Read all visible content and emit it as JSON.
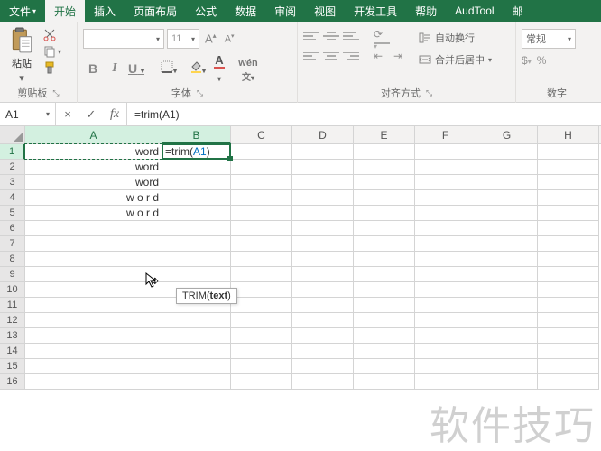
{
  "tabs": {
    "file": "文件",
    "home": "开始",
    "insert": "插入",
    "layout": "页面布局",
    "formula": "公式",
    "data": "数据",
    "review": "审阅",
    "view": "视图",
    "dev": "开发工具",
    "help": "帮助",
    "aud": "AudTool",
    "mail": "邮"
  },
  "clipboard": {
    "paste": "粘贴",
    "label": "剪贴板"
  },
  "font": {
    "name": "",
    "size": "11",
    "inc": "A",
    "dec": "A",
    "b": "B",
    "i": "I",
    "u": "U",
    "label": "字体"
  },
  "align": {
    "wrap": "自动换行",
    "merge": "合并后居中",
    "label": "对齐方式"
  },
  "number": {
    "format": "常规",
    "label": "数字"
  },
  "formula_bar": {
    "ref": "A1",
    "cancel": "×",
    "enter": "✓",
    "fx": "fx",
    "value": "=trim(A1)"
  },
  "cols": [
    "A",
    "B",
    "C",
    "D",
    "E",
    "F",
    "G",
    "H"
  ],
  "rowdata": {
    "a1": "word",
    "a2": "word",
    "a3": "word",
    "a4": "w o r d",
    "a5": "w o r d",
    "b1_pre": "=trim(",
    "b1_ref": "A1",
    "b1_post": ")"
  },
  "tooltip": {
    "fn": "TRIM(",
    "arg": "text",
    "end": ")"
  },
  "watermark": "软件技巧"
}
